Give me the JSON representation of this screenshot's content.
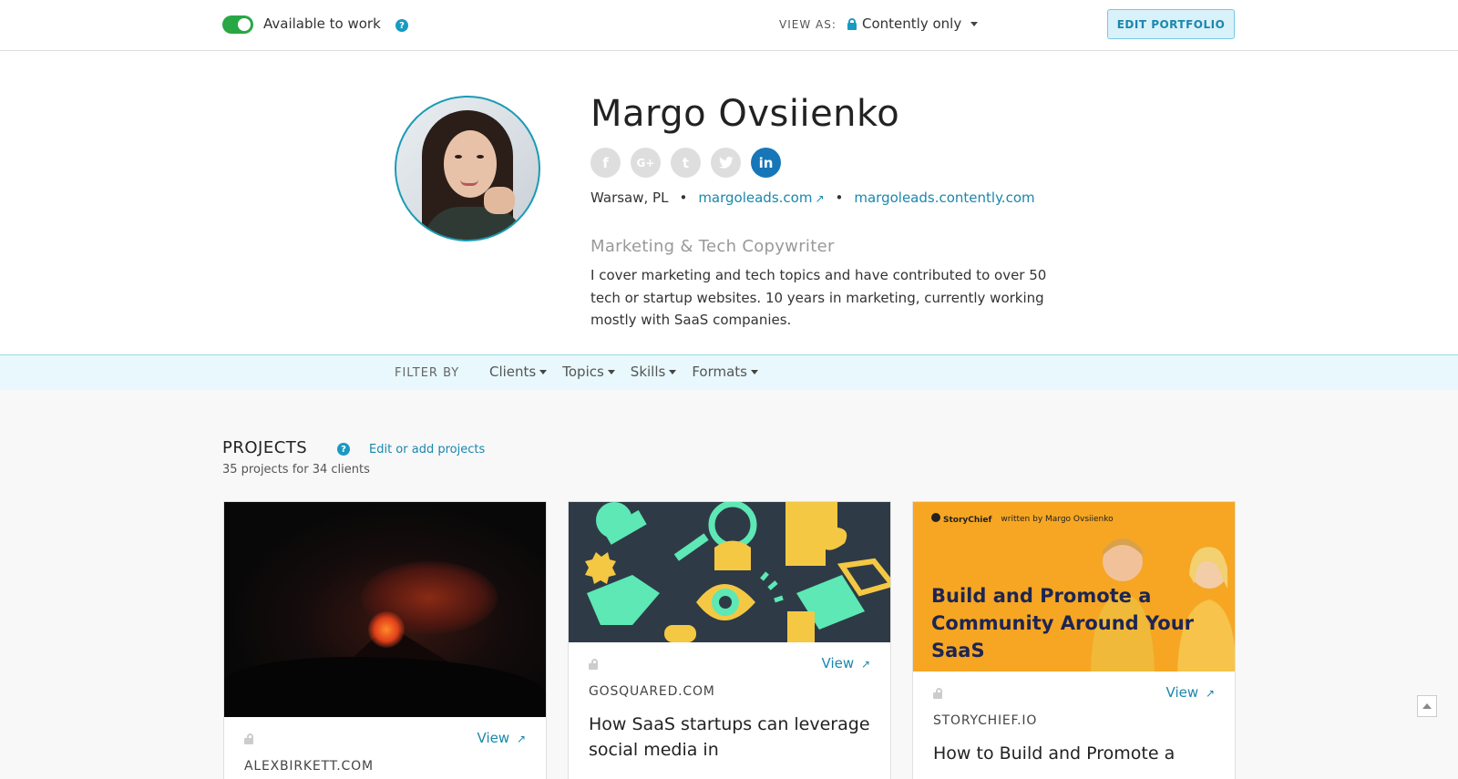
{
  "topbar": {
    "available_label": "Available to work",
    "view_as_label": "VIEW AS:",
    "view_as_value": "Contently only",
    "edit_portfolio_label": "EDIT PORTFOLIO"
  },
  "profile": {
    "name": "Margo Ovsiienko",
    "socials": [
      "f",
      "G+",
      "t",
      "tw",
      "in"
    ],
    "location": "Warsaw, PL",
    "website": "margoleads.com",
    "contently_url": "margoleads.contently.com",
    "tagline": "Marketing & Tech Copywriter",
    "bio": "I cover marketing and tech topics and have contributed to over 50 tech or startup websites. 10 years in marketing, currently working mostly with SaaS companies."
  },
  "filter": {
    "label": "FILTER BY",
    "items": [
      "Clients",
      "Topics",
      "Skills",
      "Formats"
    ]
  },
  "projects": {
    "title": "PROJECTS",
    "edit_link": "Edit or add projects",
    "summary": "35 projects for 34 clients",
    "view_label": "View",
    "cards": [
      {
        "client": "ALEXBIRKETT.COM",
        "title": ""
      },
      {
        "client": "GOSQUARED.COM",
        "title": "How SaaS startups can leverage social media in"
      },
      {
        "client": "STORYCHIEF.IO",
        "title": "How to Build and Promote a"
      }
    ],
    "storychief_thumb": {
      "brand": "StoryChief",
      "byline": "written by Margo Ovsiienko",
      "headline": "Build and Promote a Community Around Your SaaS"
    }
  },
  "colors": {
    "accent": "#1a87ad",
    "toggle_on": "#28a745",
    "linkedin": "#1776b8",
    "filter_bg": "#e8f8fc"
  }
}
